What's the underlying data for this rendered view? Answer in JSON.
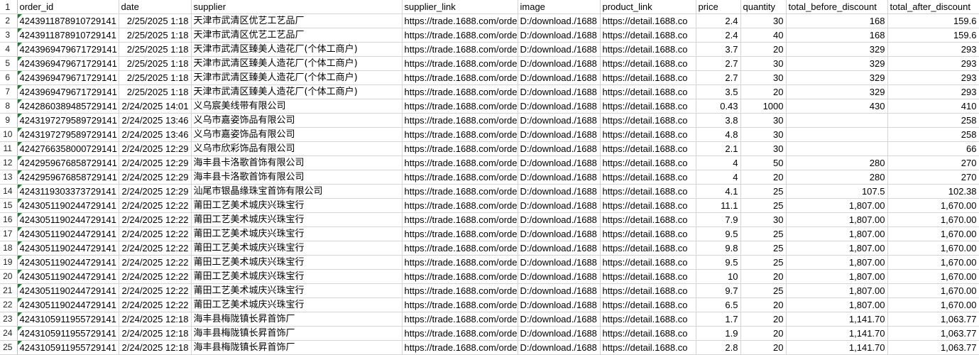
{
  "columns": [
    "order_id",
    "date",
    "supplier",
    "supplier_link",
    "image",
    "product_link",
    "price",
    "quantity",
    "total_before_discount",
    "total_after_discount"
  ],
  "header_row_number": "1",
  "rows": [
    {
      "n": "2",
      "order_id": "4243911878910729141",
      "date": "2/25/2025 1:18",
      "supplier": "天津市武清区优艺工艺品厂",
      "supplier_link": "https://trade.1688.com/order",
      "image": "D:/download./1688",
      "product_link": "https://detail.1688.co",
      "price": "2.4",
      "quantity": "30",
      "total_before_discount": "168",
      "total_after_discount": "159.6"
    },
    {
      "n": "3",
      "order_id": "4243911878910729141",
      "date": "2/25/2025 1:18",
      "supplier": "天津市武清区优艺工艺品厂",
      "supplier_link": "https://trade.1688.com/order",
      "image": "D:/download./1688",
      "product_link": "https://detail.1688.co",
      "price": "2.4",
      "quantity": "40",
      "total_before_discount": "168",
      "total_after_discount": "159.6"
    },
    {
      "n": "4",
      "order_id": "4243969479671729141",
      "date": "2/25/2025 1:18",
      "supplier": "天津市武清区臻美人造花厂(个体工商户)",
      "supplier_link": "https://trade.1688.com/order",
      "image": "D:/download./1688",
      "product_link": "https://detail.1688.co",
      "price": "3.7",
      "quantity": "20",
      "total_before_discount": "329",
      "total_after_discount": "293"
    },
    {
      "n": "5",
      "order_id": "4243969479671729141",
      "date": "2/25/2025 1:18",
      "supplier": "天津市武清区臻美人造花厂(个体工商户)",
      "supplier_link": "https://trade.1688.com/order",
      "image": "D:/download./1688",
      "product_link": "https://detail.1688.co",
      "price": "2.7",
      "quantity": "30",
      "total_before_discount": "329",
      "total_after_discount": "293"
    },
    {
      "n": "6",
      "order_id": "4243969479671729141",
      "date": "2/25/2025 1:18",
      "supplier": "天津市武清区臻美人造花厂(个体工商户)",
      "supplier_link": "https://trade.1688.com/order",
      "image": "D:/download./1688",
      "product_link": "https://detail.1688.co",
      "price": "2.7",
      "quantity": "30",
      "total_before_discount": "329",
      "total_after_discount": "293"
    },
    {
      "n": "7",
      "order_id": "4243969479671729141",
      "date": "2/25/2025 1:18",
      "supplier": "天津市武清区臻美人造花厂(个体工商户)",
      "supplier_link": "https://trade.1688.com/order",
      "image": "D:/download./1688",
      "product_link": "https://detail.1688.co",
      "price": "3.5",
      "quantity": "20",
      "total_before_discount": "329",
      "total_after_discount": "293"
    },
    {
      "n": "8",
      "order_id": "4242860389485729141",
      "date": "2/24/2025 14:01",
      "supplier": "义乌宸美线带有限公司",
      "supplier_link": "https://trade.1688.com/order",
      "image": "D:/download./1688",
      "product_link": "https://detail.1688.co",
      "price": "0.43",
      "quantity": "1000",
      "total_before_discount": "430",
      "total_after_discount": "410"
    },
    {
      "n": "9",
      "order_id": "4243197279589729141",
      "date": "2/24/2025 13:46",
      "supplier": "义乌市嘉姿饰品有限公司",
      "supplier_link": "https://trade.1688.com/order",
      "image": "D:/download./1688",
      "product_link": "https://detail.1688.co",
      "price": "3.8",
      "quantity": "30",
      "total_before_discount": "",
      "total_after_discount": "258"
    },
    {
      "n": "10",
      "order_id": "4243197279589729141",
      "date": "2/24/2025 13:46",
      "supplier": "义乌市嘉姿饰品有限公司",
      "supplier_link": "https://trade.1688.com/order",
      "image": "D:/download./1688",
      "product_link": "https://detail.1688.co",
      "price": "4.8",
      "quantity": "30",
      "total_before_discount": "",
      "total_after_discount": "258"
    },
    {
      "n": "11",
      "order_id": "4242766358000729141",
      "date": "2/24/2025 12:29",
      "supplier": "义乌市欣彩饰品有限公司",
      "supplier_link": "https://trade.1688.com/order",
      "image": "D:/download./1688",
      "product_link": "https://detail.1688.co",
      "price": "2.1",
      "quantity": "30",
      "total_before_discount": "",
      "total_after_discount": "66"
    },
    {
      "n": "12",
      "order_id": "4242959676858729141",
      "date": "2/24/2025 12:29",
      "supplier": "海丰县卡洛歌首饰有限公司",
      "supplier_link": "https://trade.1688.com/order",
      "image": "D:/download./1688",
      "product_link": "https://detail.1688.co",
      "price": "4",
      "quantity": "50",
      "total_before_discount": "280",
      "total_after_discount": "270"
    },
    {
      "n": "13",
      "order_id": "4242959676858729141",
      "date": "2/24/2025 12:29",
      "supplier": "海丰县卡洛歌首饰有限公司",
      "supplier_link": "https://trade.1688.com/order",
      "image": "D:/download./1688",
      "product_link": "https://detail.1688.co",
      "price": "4",
      "quantity": "20",
      "total_before_discount": "280",
      "total_after_discount": "270"
    },
    {
      "n": "14",
      "order_id": "4243119303373729141",
      "date": "2/24/2025 12:29",
      "supplier": "汕尾市银晶缘珠宝首饰有限公司",
      "supplier_link": "https://trade.1688.com/order",
      "image": "D:/download./1688",
      "product_link": "https://detail.1688.co",
      "price": "4.1",
      "quantity": "25",
      "total_before_discount": "107.5",
      "total_after_discount": "102.38"
    },
    {
      "n": "15",
      "order_id": "4243051190244729141",
      "date": "2/24/2025 12:22",
      "supplier": "莆田工艺美术城庆兴珠宝行",
      "supplier_link": "https://trade.1688.com/order",
      "image": "D:/download./1688",
      "product_link": "https://detail.1688.co",
      "price": "11.1",
      "quantity": "25",
      "total_before_discount": "1,807.00",
      "total_after_discount": "1,670.00"
    },
    {
      "n": "16",
      "order_id": "4243051190244729141",
      "date": "2/24/2025 12:22",
      "supplier": "莆田工艺美术城庆兴珠宝行",
      "supplier_link": "https://trade.1688.com/order",
      "image": "D:/download./1688",
      "product_link": "https://detail.1688.co",
      "price": "7.9",
      "quantity": "30",
      "total_before_discount": "1,807.00",
      "total_after_discount": "1,670.00"
    },
    {
      "n": "17",
      "order_id": "4243051190244729141",
      "date": "2/24/2025 12:22",
      "supplier": "莆田工艺美术城庆兴珠宝行",
      "supplier_link": "https://trade.1688.com/order",
      "image": "D:/download./1688",
      "product_link": "https://detail.1688.co",
      "price": "9.5",
      "quantity": "25",
      "total_before_discount": "1,807.00",
      "total_after_discount": "1,670.00"
    },
    {
      "n": "18",
      "order_id": "4243051190244729141",
      "date": "2/24/2025 12:22",
      "supplier": "莆田工艺美术城庆兴珠宝行",
      "supplier_link": "https://trade.1688.com/order",
      "image": "D:/download./1688",
      "product_link": "https://detail.1688.co",
      "price": "9.8",
      "quantity": "25",
      "total_before_discount": "1,807.00",
      "total_after_discount": "1,670.00"
    },
    {
      "n": "19",
      "order_id": "4243051190244729141",
      "date": "2/24/2025 12:22",
      "supplier": "莆田工艺美术城庆兴珠宝行",
      "supplier_link": "https://trade.1688.com/order",
      "image": "D:/download./1688",
      "product_link": "https://detail.1688.co",
      "price": "9.5",
      "quantity": "25",
      "total_before_discount": "1,807.00",
      "total_after_discount": "1,670.00"
    },
    {
      "n": "20",
      "order_id": "4243051190244729141",
      "date": "2/24/2025 12:22",
      "supplier": "莆田工艺美术城庆兴珠宝行",
      "supplier_link": "https://trade.1688.com/order",
      "image": "D:/download./1688",
      "product_link": "https://detail.1688.co",
      "price": "10",
      "quantity": "20",
      "total_before_discount": "1,807.00",
      "total_after_discount": "1,670.00"
    },
    {
      "n": "21",
      "order_id": "4243051190244729141",
      "date": "2/24/2025 12:22",
      "supplier": "莆田工艺美术城庆兴珠宝行",
      "supplier_link": "https://trade.1688.com/order",
      "image": "D:/download./1688",
      "product_link": "https://detail.1688.co",
      "price": "9.7",
      "quantity": "25",
      "total_before_discount": "1,807.00",
      "total_after_discount": "1,670.00"
    },
    {
      "n": "22",
      "order_id": "4243051190244729141",
      "date": "2/24/2025 12:22",
      "supplier": "莆田工艺美术城庆兴珠宝行",
      "supplier_link": "https://trade.1688.com/order",
      "image": "D:/download./1688",
      "product_link": "https://detail.1688.co",
      "price": "6.5",
      "quantity": "20",
      "total_before_discount": "1,807.00",
      "total_after_discount": "1,670.00"
    },
    {
      "n": "23",
      "order_id": "4243105911955729141",
      "date": "2/24/2025 12:18",
      "supplier": "海丰县梅陇镇长昇首饰厂",
      "supplier_link": "https://trade.1688.com/order",
      "image": "D:/download./1688",
      "product_link": "https://detail.1688.co",
      "price": "1.7",
      "quantity": "20",
      "total_before_discount": "1,141.70",
      "total_after_discount": "1,063.77"
    },
    {
      "n": "24",
      "order_id": "4243105911955729141",
      "date": "2/24/2025 12:18",
      "supplier": "海丰县梅陇镇长昇首饰厂",
      "supplier_link": "https://trade.1688.com/order",
      "image": "D:/download./1688",
      "product_link": "https://detail.1688.co",
      "price": "1.9",
      "quantity": "20",
      "total_before_discount": "1,141.70",
      "total_after_discount": "1,063.77"
    },
    {
      "n": "25",
      "order_id": "4243105911955729141",
      "date": "2/24/2025 12:18",
      "supplier": "海丰县梅陇镇长昇首饰厂",
      "supplier_link": "https://trade.1688.com/order",
      "image": "D:/download./1688",
      "product_link": "https://detail.1688.co",
      "price": "2.8",
      "quantity": "20",
      "total_before_discount": "1,141.70",
      "total_after_discount": "1,063.77"
    }
  ]
}
